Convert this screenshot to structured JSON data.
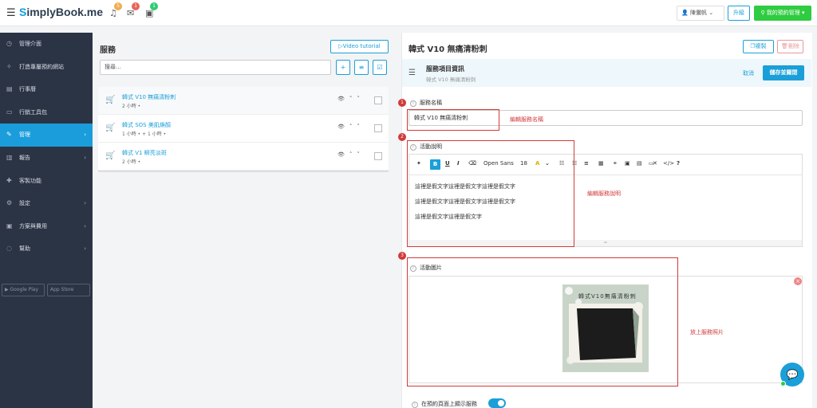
{
  "header": {
    "logo_s": "S",
    "logo_rest": "implyBook.me",
    "notifications": [
      {
        "icon": "bell-icon",
        "count": "5",
        "color": "#f0ad4e"
      },
      {
        "icon": "mail-icon",
        "count": "1",
        "color": "#e9645a"
      },
      {
        "icon": "calendar-check-icon",
        "count": "1",
        "color": "#2ecc71"
      }
    ],
    "user_name": "陳儷帆",
    "upgrade_label": "升級",
    "my_booking_label": "我的預約管理"
  },
  "sidebar": {
    "items": [
      {
        "label": "管理介面",
        "icon": "dashboard-icon",
        "arrow": false,
        "active": false
      },
      {
        "label": "打造專屬預約網站",
        "icon": "bulb-icon",
        "arrow": false,
        "active": false
      },
      {
        "label": "行事曆",
        "icon": "calendar-icon",
        "arrow": false,
        "active": false
      },
      {
        "label": "行銷工具包",
        "icon": "briefcase-icon",
        "arrow": false,
        "active": false
      },
      {
        "label": "管理",
        "icon": "pencil-icon",
        "arrow": true,
        "active": true
      },
      {
        "label": "報告",
        "icon": "chart-icon",
        "arrow": true,
        "active": false
      },
      {
        "label": "客製功能",
        "icon": "puzzle-icon",
        "arrow": false,
        "active": false
      },
      {
        "label": "設定",
        "icon": "gear-icon",
        "arrow": true,
        "active": false
      },
      {
        "label": "方案與費用",
        "icon": "wallet-icon",
        "arrow": true,
        "active": false
      },
      {
        "label": "幫助",
        "icon": "help-icon",
        "arrow": true,
        "active": false
      }
    ],
    "stores": [
      "Google Play",
      "App Store"
    ]
  },
  "services": {
    "title": "服務",
    "video_label": "Video tutorial",
    "search_placeholder": "搜尋...",
    "items": [
      {
        "name": "韓式 V10 無痛清粉刺",
        "duration": "2 小時 •",
        "selected": true
      },
      {
        "name": "韓式 SOS 美肌煥顏",
        "duration": "1 小時 • + 1 小時 •",
        "selected": false
      },
      {
        "name": "韓式 V1 瞬亮淡斑",
        "duration": "2 小時 •",
        "selected": false
      }
    ]
  },
  "detail": {
    "title": "韓式 V10 無痛清粉刺",
    "copy_label": "複製",
    "delete_label": "刪除",
    "section_title": "服務項目資訊",
    "section_sub": "韓式 V10 無痛清粉刺",
    "cancel_label": "取消",
    "save_label": "儲存並關閉",
    "name_label": "服務名稱",
    "name_value": "韓式 V10 無痛清粉刺",
    "desc_label": "活動說明",
    "toolbar": {
      "font": "Open Sans",
      "size": "18"
    },
    "desc_lines": [
      "這裡是假文字這裡是假文字這裡是假文字",
      "這裡是假文字這裡是假文字這裡是假文字",
      "這裡是假文字這裡是假文字"
    ],
    "image_label": "活動圖片",
    "photo_caption": "韓式V10無痛清粉刺",
    "show_label": "在預約頁面上顯示服務"
  },
  "annotations": [
    {
      "num": "1",
      "text": "編輯服務名稱"
    },
    {
      "num": "2",
      "text": "編輯服務說明"
    },
    {
      "num": "3",
      "text": "放上服務照片"
    }
  ]
}
